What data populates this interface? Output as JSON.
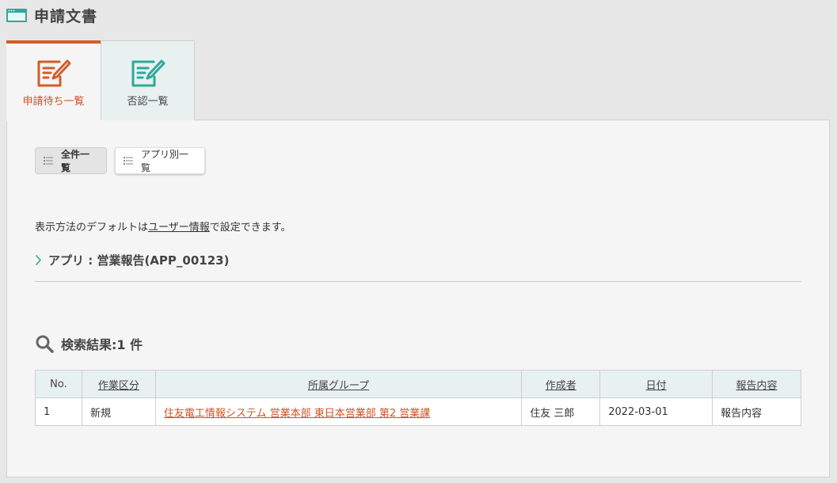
{
  "page": {
    "title": "申請文書"
  },
  "colors": {
    "accent": "#d35d2b",
    "link": "#cc5424",
    "teal": "#2ea89a",
    "header_bg": "#e7f1ef"
  },
  "tabs": [
    {
      "label": "申請待ち一覧",
      "icon": "edit-document-icon",
      "active": true
    },
    {
      "label": "否認一覧",
      "icon": "edit-document-icon",
      "active": false
    }
  ],
  "view_buttons": [
    {
      "label": "全件一覧",
      "icon": "list-icon",
      "selected": true
    },
    {
      "label": "アプリ別一覧",
      "icon": "list-icon",
      "selected": false
    }
  ],
  "info": {
    "prefix": "表示方法のデフォルトは",
    "link": "ユーザー情報",
    "suffix": "で設定できます。"
  },
  "app_section": {
    "title": "アプリ : 営業報告(APP_00123)",
    "icon": "chevron-right-icon"
  },
  "results": {
    "title": "検索結果:1 件",
    "icon": "search-icon"
  },
  "table": {
    "headers": [
      "No.",
      "作業区分",
      "所属グループ",
      "作成者",
      "日付",
      "報告内容"
    ],
    "rows": [
      [
        "1",
        "新規",
        "住友電工情報システム 営業本部 東日本営業部 第2 営業課",
        "住友 三郎",
        "2022-03-01",
        "報告内容"
      ]
    ]
  }
}
